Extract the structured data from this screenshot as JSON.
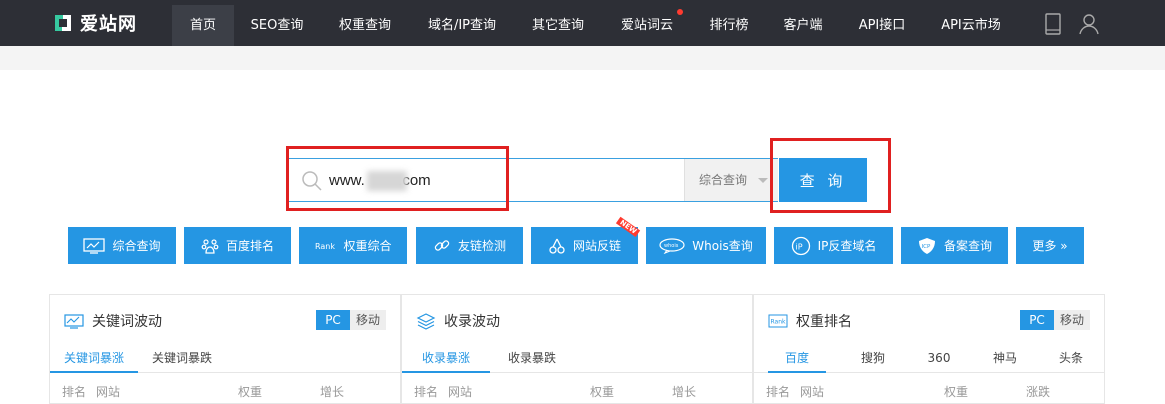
{
  "brand": {
    "name": "爱站网"
  },
  "nav": {
    "items": [
      {
        "label": "首页"
      },
      {
        "label": "SEO查询"
      },
      {
        "label": "权重查询"
      },
      {
        "label": "域名/IP查询"
      },
      {
        "label": "其它查询"
      },
      {
        "label": "爱站词云"
      },
      {
        "label": "排行榜"
      },
      {
        "label": "客户端"
      },
      {
        "label": "API接口"
      },
      {
        "label": "API云市场"
      }
    ]
  },
  "search": {
    "value": "www.        .com",
    "select": "综合查询",
    "button": "查 询"
  },
  "quick_buttons": [
    {
      "label": "综合查询",
      "icon": "monitor-icon"
    },
    {
      "label": "百度排名",
      "icon": "baidu-paw-icon"
    },
    {
      "label": "权重综合",
      "icon": "rank-icon"
    },
    {
      "label": "友链检测",
      "icon": "link-icon"
    },
    {
      "label": "网站反链",
      "icon": "backlink-icon",
      "badge": "NEW"
    },
    {
      "label": "Whois查询",
      "icon": "whois-icon"
    },
    {
      "label": "IP反查域名",
      "icon": "ip-icon"
    },
    {
      "label": "备案查询",
      "icon": "icp-icon"
    },
    {
      "label": "更多 »",
      "icon": ""
    }
  ],
  "panels": {
    "keywords": {
      "title": "关键词波动",
      "pc": "PC",
      "mobile": "移动",
      "tabs": [
        "关键词暴涨",
        "关键词暴跌"
      ],
      "cols": [
        "排名",
        "网站",
        "权重",
        "增长"
      ]
    },
    "index": {
      "title": "收录波动",
      "tabs": [
        "收录暴涨",
        "收录暴跌"
      ],
      "cols": [
        "排名",
        "网站",
        "权重",
        "增长"
      ]
    },
    "rank": {
      "title": "权重排名",
      "pc": "PC",
      "mobile": "移动",
      "tabs": [
        "百度",
        "搜狗",
        "360",
        "神马",
        "头条"
      ],
      "cols": [
        "排名",
        "网站",
        "权重",
        "涨跌"
      ]
    }
  },
  "colors": {
    "accent": "#2596e3",
    "nav_bg": "#2d2f36",
    "highlight": "#e02020"
  }
}
